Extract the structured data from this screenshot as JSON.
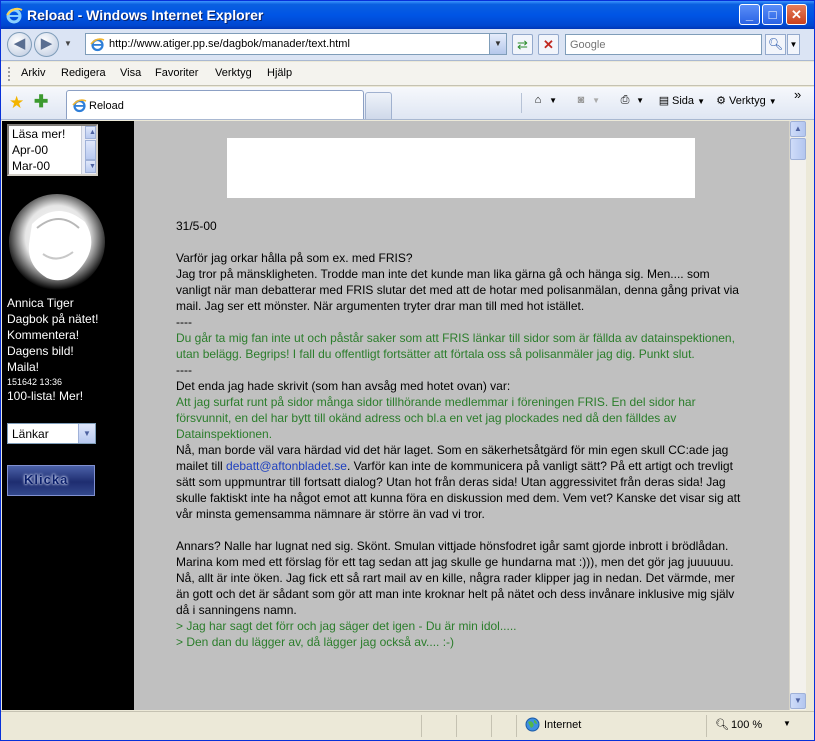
{
  "window": {
    "title": "Reload - Windows Internet Explorer",
    "min_glyph": "_",
    "max_glyph": "□",
    "close_glyph": "✕"
  },
  "address": {
    "url": "http://www.atiger.pp.se/dagbok/manader/text.html"
  },
  "search": {
    "placeholder": "Google"
  },
  "menu": [
    "Arkiv",
    "Redigera",
    "Visa",
    "Favoriter",
    "Verktyg",
    "Hjälp"
  ],
  "tab": {
    "label": "Reload"
  },
  "tools": {
    "page_label": "Sida",
    "tools_label": "Verktyg",
    "more": "»"
  },
  "sidebar": {
    "archive_list": [
      "Läsa mer!",
      "Apr-00",
      "Mar-00"
    ],
    "name": "Annica Tiger",
    "links": [
      "Dagbok på nätet!",
      "Kommentera!",
      "Dagens bild!",
      "Maila!"
    ],
    "counter": "151642 13:36",
    "top_list": "100-lista! Mer!",
    "links_select": "Länkar",
    "klicka_label": "Klicka"
  },
  "article": {
    "date": "31/5-00",
    "p1": "Varför jag orkar hålla på som ex. med FRIS?",
    "p2": "Jag tror på mänskligheten. Trodde man inte det kunde man lika gärna gå och hänga sig. Men.... som vanligt när man debatterar med FRIS slutar det med att de hotar med polisanmälan, denna gång privat via mail. Jag ser ett mönster. När argumenten tryter drar man till med hot istället.",
    "sep1": "----",
    "quote1": "Du går ta mig fan inte ut och påstår saker som att FRIS länkar till sidor som är fällda av datainspektionen, utan belägg. Begrips! I fall du offentligt fortsätter att förtala oss så polisanmäler jag dig. Punkt slut.",
    "sep2": "----",
    "p3": "Det enda jag hade skrivit (som han avsåg med hotet ovan) var:",
    "quote2": "Att jag surfat runt på sidor många sidor tillhörande medlemmar i föreningen FRIS. En del sidor har försvunnit, en del har bytt till okänd adress och bl.a en vet jag plockades ned då den fälldes av Datainspektionen.",
    "p4_start": "Nå, man borde väl vara härdad vid det här laget. Som en säkerhetsåtgärd för min egen skull CC:ade jag mailet till ",
    "p4_email": "debatt@aftonbladet.se",
    "p4_end": ". Varför kan inte de kommunicera på vanligt sätt? På ett artigt och trevligt sätt som uppmuntrar till fortsatt dialog? Utan hot från deras sida! Utan aggressivitet från deras sida! Jag skulle faktiskt inte ha något emot att kunna föra en diskussion med dem. Vem vet? Kanske det visar sig att vår minsta gemensamma nämnare är större än vad vi tror.",
    "p5": "Annars? Nalle har lugnat ned sig. Skönt. Smulan vittjade hönsfodret igår samt gjorde inbrott i brödlådan. Marina kom med ett förslag för ett tag sedan att jag skulle ge hundarna mat :))), men det gör jag juuuuuu. Nå, allt är inte öken. Jag fick ett så rart mail av en kille, några rader klipper jag in nedan. Det värmde, mer än gott och det är sådant som gör att man inte kroknar helt på nätet och dess invånare inklusive mig själv då i sanningens namn.",
    "quote3": "> Jag har sagt det förr och jag säger det igen - Du är min idol.....",
    "quote4": "> Den dan du lägger av, då lägger jag också av.... :-)"
  },
  "status": {
    "zone": "Internet",
    "zoom": "100 %"
  },
  "colors": {
    "titlebar": "#0055e5",
    "content_bg": "#c0c0c0",
    "sidebar_bg": "#000000",
    "quote_green": "#2b7d2b",
    "link_blue": "#1d3fbf"
  }
}
